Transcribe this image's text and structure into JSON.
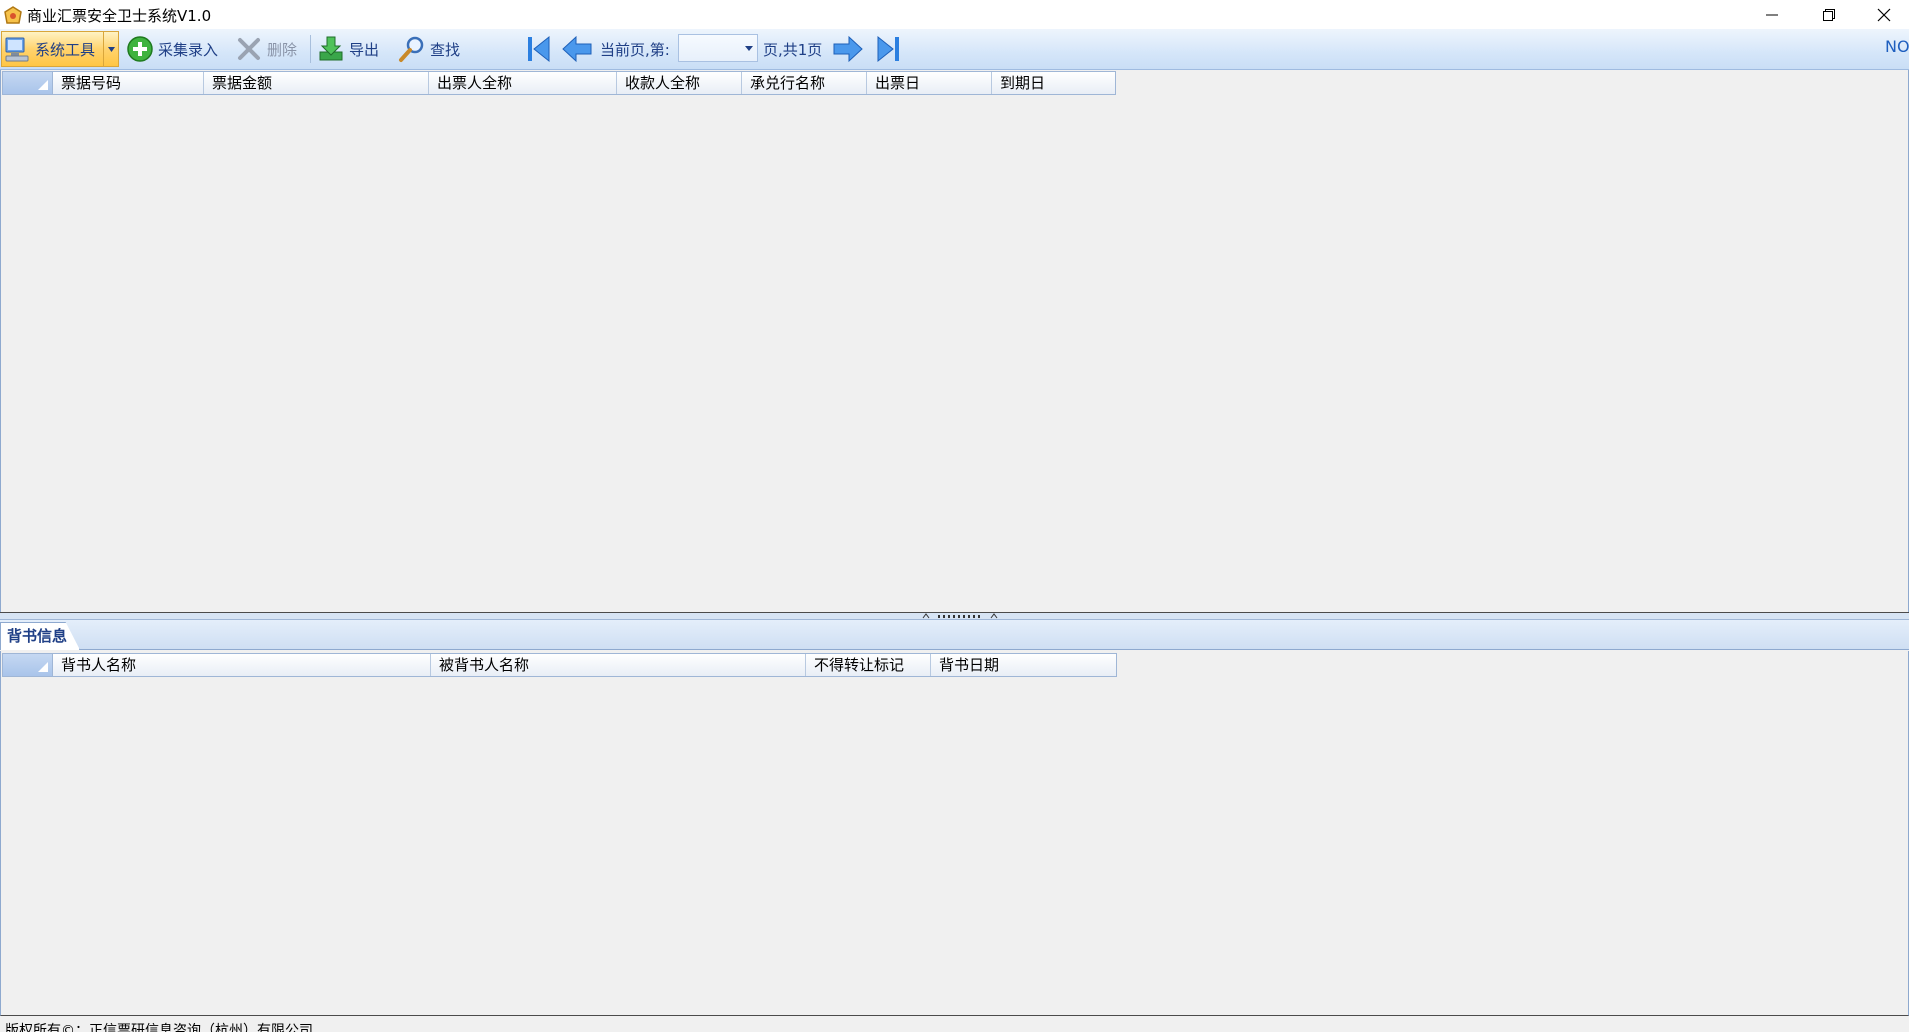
{
  "window": {
    "title": "商业汇票安全卫士系统V1.0"
  },
  "toolbar": {
    "system_tools": "系统工具",
    "capture_entry": "采集录入",
    "delete": "删除",
    "export": "导出",
    "find": "查找",
    "current_page_label": "当前页,第:",
    "current_page_value": "",
    "total_pages_label": "页,共1页",
    "right_text": "NO"
  },
  "main_grid": {
    "columns": [
      "票据号码",
      "票据金额",
      "出票人全称",
      "收款人全称",
      "承兑行名称",
      "出票日",
      "到期日"
    ]
  },
  "tabs": [
    {
      "label": "背书信息",
      "active": true
    }
  ],
  "endorse_grid": {
    "columns": [
      "背书人名称",
      "被背书人名称",
      "不得转让标记",
      "背书日期"
    ]
  },
  "status": {
    "copyright": "版权所有©：正信票研信息咨询（杭州）有限公司"
  },
  "colors": {
    "toolbar_text": "#1f3f86",
    "accent_blue": "#2b7fe0",
    "active_button": "#ffd36e"
  }
}
